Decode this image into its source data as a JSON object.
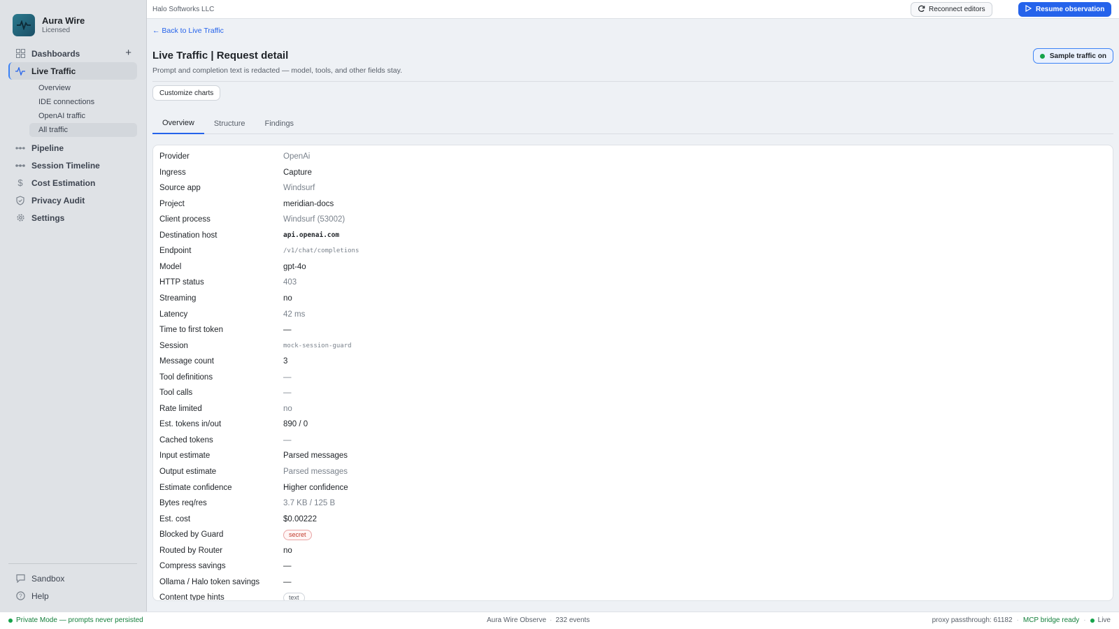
{
  "brand": {
    "name": "Aura Wire",
    "license": "Licensed"
  },
  "nav": {
    "dashboards": "Dashboards",
    "live_traffic": "Live Traffic",
    "live_sub": [
      "Overview",
      "IDE connections",
      "OpenAI traffic",
      "All traffic"
    ],
    "pipeline": "Pipeline",
    "session_timeline": "Session Timeline",
    "cost_estimation": "Cost Estimation",
    "privacy_audit": "Privacy Audit",
    "settings": "Settings",
    "sandbox": "Sandbox",
    "help": "Help"
  },
  "topbar": {
    "org": "Halo Softworks LLC",
    "reconnect": "Reconnect editors",
    "resume": "Resume observation"
  },
  "page": {
    "back": "← Back to Live Traffic",
    "title": "Live Traffic | Request detail",
    "subtitle": "Prompt and completion text is redacted — model, tools, and other fields stay.",
    "sample": "Sample traffic on",
    "customize": "Customize charts",
    "tabs": [
      "Overview",
      "Structure",
      "Findings"
    ]
  },
  "details": [
    {
      "k": "Provider",
      "v": "OpenAi"
    },
    {
      "k": "Ingress",
      "v": "Capture"
    },
    {
      "k": "Source app",
      "v": "Windsurf"
    },
    {
      "k": "Project",
      "v": "meridian-docs"
    },
    {
      "k": "Client process",
      "v": "Windsurf (53002)"
    },
    {
      "k": "Destination host",
      "v": "api.openai.com"
    },
    {
      "k": "Endpoint",
      "v": "/v1/chat/completions"
    },
    {
      "k": "Model",
      "v": "gpt-4o"
    },
    {
      "k": "HTTP status",
      "v": "403"
    },
    {
      "k": "Streaming",
      "v": "no"
    },
    {
      "k": "Latency",
      "v": "42 ms"
    },
    {
      "k": "Time to first token",
      "v": "—"
    },
    {
      "k": "Session",
      "v": "mock-session-guard"
    },
    {
      "k": "Message count",
      "v": "3"
    },
    {
      "k": "Tool definitions",
      "v": "—"
    },
    {
      "k": "Tool calls",
      "v": "—"
    },
    {
      "k": "Rate limited",
      "v": "no"
    },
    {
      "k": "Est. tokens in/out",
      "v": "890 / 0"
    },
    {
      "k": "Cached tokens",
      "v": "—"
    },
    {
      "k": "Input estimate",
      "v": "Parsed messages"
    },
    {
      "k": "Output estimate",
      "v": "Parsed messages"
    },
    {
      "k": "Estimate confidence",
      "v": "Higher confidence"
    },
    {
      "k": "Bytes req/res",
      "v": "3.7 KB / 125 B"
    },
    {
      "k": "Est. cost",
      "v": "$0.00222"
    },
    {
      "k": "Blocked by Guard",
      "v": "secret"
    },
    {
      "k": "Routed by Router",
      "v": "no"
    },
    {
      "k": "Compress savings",
      "v": "—"
    },
    {
      "k": "Ollama / Halo token savings",
      "v": "—"
    },
    {
      "k": "Content type hints",
      "v": "text"
    }
  ],
  "status": {
    "private": "Private Mode — prompts never persisted",
    "app": "Aura Wire Observe",
    "events": "232 events",
    "proxy": "proxy passthrough: 61182",
    "mcp": "MCP bridge ready",
    "live": "Live"
  },
  "colors": {
    "accent": "#2563eb",
    "ok": "#16a34a",
    "danger": "#c0392b"
  }
}
